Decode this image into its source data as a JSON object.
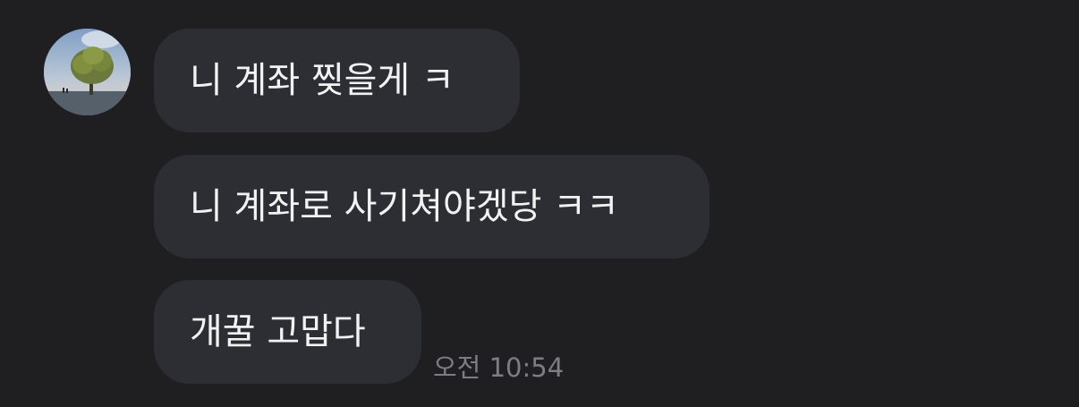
{
  "chat": {
    "avatar_icon": "tree-landscape-avatar",
    "messages": [
      {
        "text": "니 계좌 찢을게 ㅋ"
      },
      {
        "text": "니 계좌로 사기쳐야겠당 ㅋㅋ"
      },
      {
        "text": "개꿀 고맙다"
      }
    ],
    "timestamp": "오전 10:54"
  },
  "colors": {
    "background": "#1f1f21",
    "bubble": "#2c2e33",
    "text": "#f2f2f2",
    "timestamp": "#7c7e83"
  }
}
